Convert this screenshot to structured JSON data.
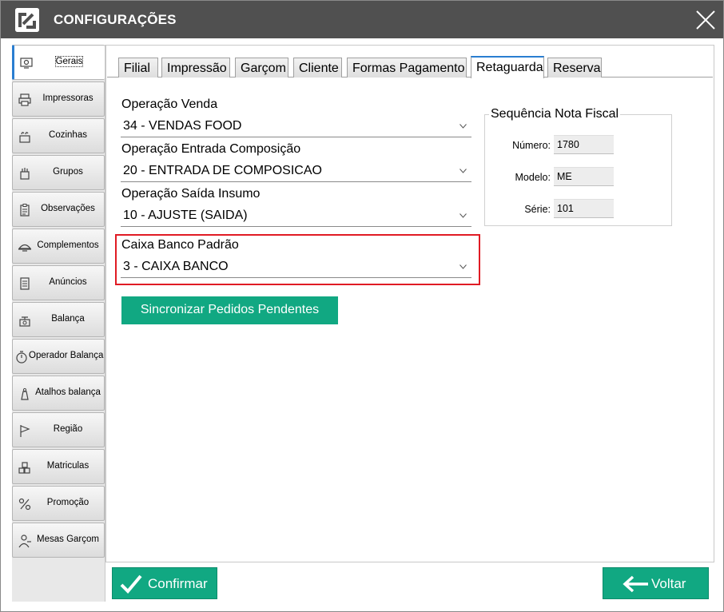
{
  "window": {
    "title": "CONFIGURAÇÕES",
    "logo_icon": "app-logo-icon",
    "close_icon": "close-icon"
  },
  "sidebar": {
    "items": [
      {
        "label": "Gerais",
        "icon": "settings-monitor-icon",
        "active": true
      },
      {
        "label": "Impressoras",
        "icon": "printer-icon"
      },
      {
        "label": "Cozinhas",
        "icon": "kitchen-icon"
      },
      {
        "label": "Grupos",
        "icon": "groups-icon"
      },
      {
        "label": "Observações",
        "icon": "clipboard-icon"
      },
      {
        "label": "Complementos",
        "icon": "dish-icon"
      },
      {
        "label": "Anúncios",
        "icon": "document-icon"
      },
      {
        "label": "Balança",
        "icon": "scale-icon"
      },
      {
        "label": "Operador Balança",
        "icon": "scale-timer-icon"
      },
      {
        "label": "Atalhos balança",
        "icon": "scale-weight-icon"
      },
      {
        "label": "Região",
        "icon": "flag-icon"
      },
      {
        "label": "Matriculas",
        "icon": "boxes-icon"
      },
      {
        "label": "Promoção",
        "icon": "promotion-icon"
      },
      {
        "label": "Mesas Garçom",
        "icon": "waiter-icon"
      }
    ]
  },
  "tabs": [
    {
      "label": "Filial"
    },
    {
      "label": "Impressão"
    },
    {
      "label": "Garçom"
    },
    {
      "label": "Cliente"
    },
    {
      "label": "Formas Pagamento"
    },
    {
      "label": "Retaguarda",
      "active": true
    },
    {
      "label": "Reserva"
    }
  ],
  "form": {
    "operacao_venda": {
      "label": "Operação Venda",
      "value": "34 - VENDAS FOOD"
    },
    "operacao_entrada": {
      "label": "Operação Entrada Composição",
      "value": "20 - ENTRADA DE COMPOSICAO"
    },
    "operacao_saida": {
      "label": "Operação Saída Insumo",
      "value": "10 - AJUSTE (SAIDA)"
    },
    "caixa_banco": {
      "label": "Caixa Banco Padrão",
      "value": "3 - CAIXA BANCO"
    },
    "sync_button": "Sincronizar Pedidos Pendentes"
  },
  "sequencia": {
    "title": "Sequência Nota Fiscal",
    "numero_label": "Número:",
    "numero_value": "1780",
    "modelo_label": "Modelo:",
    "modelo_value": "ME",
    "serie_label": "Série:",
    "serie_value": "101"
  },
  "footer": {
    "confirm_label": "Confirmar",
    "back_label": "Voltar"
  },
  "colors": {
    "titlebar": "#505050",
    "accent_green": "#11a882",
    "highlight_red": "#e01b24",
    "active_tab_blue": "#2a7ed1"
  }
}
